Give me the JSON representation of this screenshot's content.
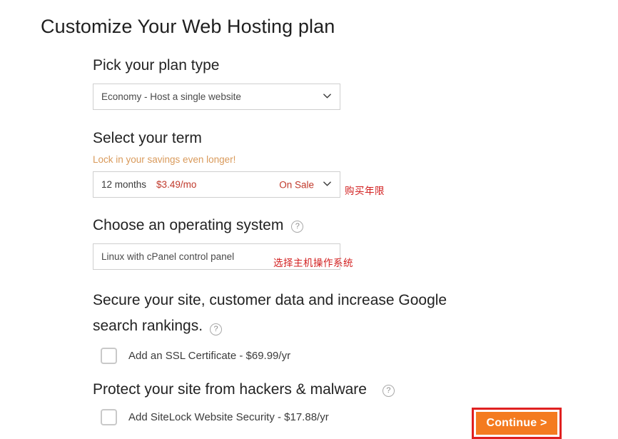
{
  "page": {
    "title": "Customize Your Web Hosting plan"
  },
  "plan_type": {
    "label": "Pick your plan type",
    "selected": "Economy - Host a single website",
    "chevron_icon": "chevron-down-icon"
  },
  "term": {
    "label": "Select your term",
    "promo": "Lock in your savings even longer!",
    "months": "12 months",
    "price": "$3.49/mo",
    "sale_badge": "On Sale",
    "chevron_icon": "chevron-down-icon",
    "annotation_cn": "购买年限"
  },
  "operating_system": {
    "label": "Choose an operating system",
    "help_icon": "help-circle-icon",
    "help_glyph": "?",
    "selected": "Linux with cPanel control panel",
    "annotation_cn": "选择主机操作系统"
  },
  "ssl": {
    "label": "Secure your site, customer data and increase Google search rankings.",
    "help_icon": "help-circle-icon",
    "help_glyph": "?",
    "checkbox_label": "Add an SSL Certificate - $69.99/yr",
    "checked": false
  },
  "sitelock": {
    "label": "Protect your site from hackers & malware",
    "help_icon": "help-circle-icon",
    "help_glyph": "?",
    "checkbox_label": "Add SiteLock Website Security - $17.88/yr",
    "checked": false
  },
  "cta": {
    "continue_label": "Continue >",
    "button_color": "#f47b20",
    "highlight_color": "#e02020"
  },
  "colors": {
    "promo_orange": "#d99a5b",
    "price_red": "#c0392b",
    "annotation_red": "#d21f1f",
    "border_gray": "#cfcfcf",
    "text_dark": "#232323"
  }
}
